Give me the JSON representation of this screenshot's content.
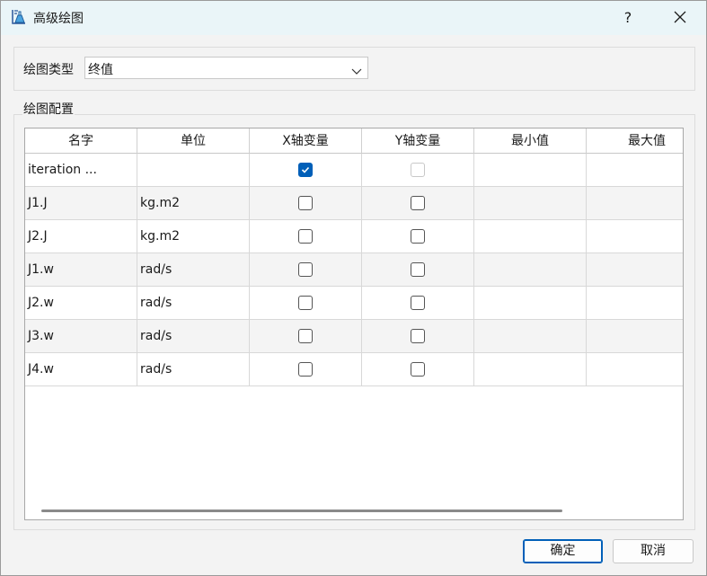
{
  "window": {
    "title": "高级绘图",
    "help": "?",
    "icon": "plot-app-icon"
  },
  "plot_type": {
    "label": "绘图类型",
    "value": "终值"
  },
  "config": {
    "label": "绘图配置",
    "columns": [
      "名字",
      "单位",
      "X轴变量",
      "Y轴变量",
      "最小值",
      "最大值"
    ],
    "rows": [
      {
        "name": "iteration ...",
        "unit": "",
        "x": true,
        "y": false,
        "y_disabled": true
      },
      {
        "name": "J1.J",
        "unit": "kg.m2",
        "x": false,
        "y": false
      },
      {
        "name": "J2.J",
        "unit": "kg.m2",
        "x": false,
        "y": false
      },
      {
        "name": "J1.w",
        "unit": "rad/s",
        "x": false,
        "y": false
      },
      {
        "name": "J2.w",
        "unit": "rad/s",
        "x": false,
        "y": false
      },
      {
        "name": "J3.w",
        "unit": "rad/s",
        "x": false,
        "y": false
      },
      {
        "name": "J4.w",
        "unit": "rad/s",
        "x": false,
        "y": false
      }
    ]
  },
  "buttons": {
    "ok": "确定",
    "cancel": "取消"
  },
  "colors": {
    "accent": "#005fb8",
    "titlebar": "#eaf5f8"
  }
}
